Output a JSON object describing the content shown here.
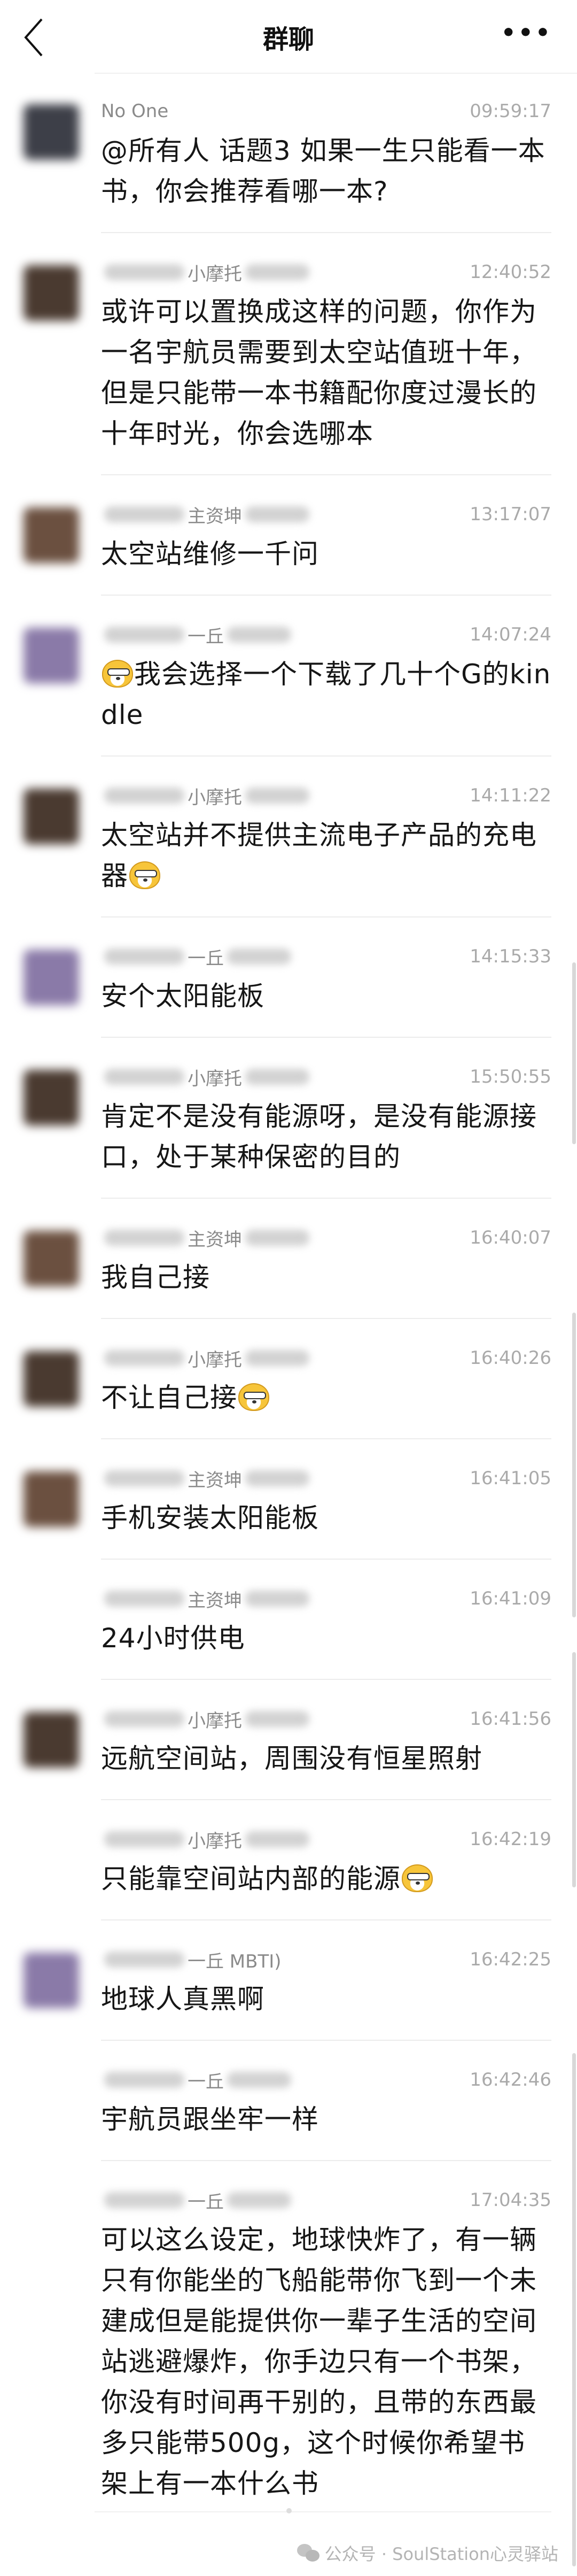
{
  "header": {
    "title": "群聊",
    "back_icon": "chevron-left-icon",
    "more_icon": "more-dots-icon",
    "more_label": "•••"
  },
  "colors": {
    "name": "#8a8a8a",
    "time": "#aaaaaa",
    "text": "#161616",
    "divider": "#ececec"
  },
  "messages": [
    {
      "name": "No One",
      "blur_before": false,
      "blur_after": false,
      "time": "09:59:17",
      "avatar": "#3d3f48",
      "parts": [
        {
          "t": "@所有人 话题3 如果一生只能看一本书，你会推荐看哪一本?"
        }
      ]
    },
    {
      "name": "小摩托",
      "blur_before": true,
      "blur_after": true,
      "time": "12:40:52",
      "avatar": "#4a3a30",
      "parts": [
        {
          "t": "或许可以置换成这样的问题，你作为一名宇航员需要到太空站值班十年，但是只能带一本书籍配你度过漫长的十年时光，你会选哪本"
        }
      ]
    },
    {
      "name": "主资坤",
      "blur_before": true,
      "blur_after": true,
      "time": "13:17:07",
      "avatar": "#6b5040",
      "parts": [
        {
          "t": "太空站维修一千问"
        }
      ]
    },
    {
      "name": "一丘",
      "blur_before": true,
      "blur_after": true,
      "time": "14:07:24",
      "avatar": "#8a7aa8",
      "parts": [
        {
          "emoji": "doge"
        },
        {
          "t": "我会选择一个下载了几十个G的kindle"
        }
      ]
    },
    {
      "name": "小摩托",
      "blur_before": true,
      "blur_after": true,
      "time": "14:11:22",
      "avatar": "#4a3a30",
      "parts": [
        {
          "t": "太空站并不提供主流电子产品的充电器"
        },
        {
          "emoji": "doge"
        }
      ]
    },
    {
      "name": "一丘",
      "blur_before": true,
      "blur_after": true,
      "time": "14:15:33",
      "avatar": "#8a7aa8",
      "parts": [
        {
          "t": "安个太阳能板"
        }
      ]
    },
    {
      "name": "小摩托",
      "blur_before": true,
      "blur_after": true,
      "time": "15:50:55",
      "avatar": "#4a3a30",
      "parts": [
        {
          "t": "肯定不是没有能源呀，是没有能源接口，处于某种保密的目的"
        }
      ]
    },
    {
      "name": "主资坤",
      "blur_before": true,
      "blur_after": true,
      "time": "16:40:07",
      "avatar": "#6b5040",
      "parts": [
        {
          "t": "我自己接"
        }
      ]
    },
    {
      "name": "小摩托",
      "blur_before": true,
      "blur_after": true,
      "time": "16:40:26",
      "avatar": "#4a3a30",
      "parts": [
        {
          "t": "不让自己接"
        },
        {
          "emoji": "doge"
        }
      ]
    },
    {
      "name": "主资坤",
      "blur_before": true,
      "blur_after": true,
      "time": "16:41:05",
      "avatar": "#6b5040",
      "parts": [
        {
          "t": "手机安装太阳能板"
        }
      ]
    },
    {
      "name": "主资坤",
      "blur_before": true,
      "blur_after": true,
      "time": "16:41:09",
      "avatar": null,
      "parts": [
        {
          "t": "24小时供电"
        }
      ]
    },
    {
      "name": "小摩托",
      "blur_before": true,
      "blur_after": true,
      "time": "16:41:56",
      "avatar": "#4a3a30",
      "parts": [
        {
          "t": "远航空间站，周围没有恒星照射"
        }
      ]
    },
    {
      "name": "小摩托",
      "blur_before": true,
      "blur_after": true,
      "time": "16:42:19",
      "avatar": null,
      "parts": [
        {
          "t": "只能靠空间站内部的能源"
        },
        {
          "emoji": "doge"
        }
      ]
    },
    {
      "name": "一丘 MBTI)",
      "blur_before": true,
      "blur_after": false,
      "time": "16:42:25",
      "avatar": "#8a7aa8",
      "parts": [
        {
          "t": "地球人真黑啊"
        }
      ]
    },
    {
      "name": "一丘",
      "blur_before": true,
      "blur_after": true,
      "time": "16:42:46",
      "avatar": null,
      "parts": [
        {
          "t": "宇航员跟坐牢一样"
        }
      ]
    },
    {
      "name": "一丘",
      "blur_before": true,
      "blur_after": true,
      "time": "17:04:35",
      "avatar": null,
      "parts": [
        {
          "t": "可以这么设定，地球快炸了，有一辆只有你能坐的飞船能带你飞到一个未建成但是能提供你一辈子生活的空间站逃避爆炸，你手边只有一个书架，你没有时间再干别的，且带的东西最多只能带500g，这个时候你希望书架上有一本什么书"
        }
      ]
    }
  ],
  "watermark": {
    "icon": "wechat-icon",
    "text": "公众号 · SoulStation心灵驿站"
  }
}
